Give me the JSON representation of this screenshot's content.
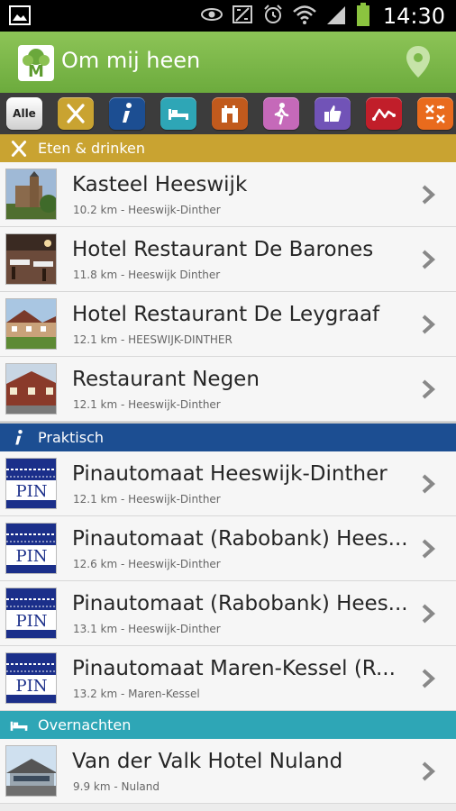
{
  "status_bar": {
    "time": "14:30",
    "icons": [
      "image-icon",
      "eye-icon",
      "nfc-icon",
      "alarm-icon",
      "wifi-icon",
      "signal-icon",
      "battery-icon"
    ]
  },
  "action_bar": {
    "title": "Om mij heen",
    "logo_letter": "M",
    "location_icon": "location-pin-icon",
    "color": "#7bb84a"
  },
  "filters": [
    {
      "label": "Alle",
      "icon": "text",
      "color": "#e6e6e6"
    },
    {
      "label": "",
      "icon": "fork-knife-icon",
      "color": "#c9a331"
    },
    {
      "label": "",
      "icon": "info-icon",
      "color": "#1c4e92"
    },
    {
      "label": "",
      "icon": "bed-icon",
      "color": "#2ea6b6"
    },
    {
      "label": "",
      "icon": "castle-icon",
      "color": "#c15a1d"
    },
    {
      "label": "",
      "icon": "walker-icon",
      "color": "#c569b9"
    },
    {
      "label": "",
      "icon": "thumbs-up-icon",
      "color": "#7153b7"
    },
    {
      "label": "",
      "icon": "route-icon",
      "color": "#c11e2a"
    },
    {
      "label": "",
      "icon": "tools-icon",
      "color": "#e96b1d"
    }
  ],
  "sections": [
    {
      "title": "Eten & drinken",
      "icon": "fork-knife-icon",
      "color": "#c9a331",
      "items": [
        {
          "title": "Kasteel Heeswijk",
          "subtitle": "10.2 km - Heeswijk-Dinther",
          "thumb": "castle-photo"
        },
        {
          "title": "Hotel Restaurant De Barones",
          "subtitle": "11.8 km - Heeswijk Dinther",
          "thumb": "dining-photo"
        },
        {
          "title": "Hotel Restaurant De Leygraaf",
          "subtitle": "12.1 km - HEESWIJK-DINTHER",
          "thumb": "building-photo"
        },
        {
          "title": "Restaurant Negen",
          "subtitle": "12.1 km - Heeswijk-Dinther",
          "thumb": "brick-photo"
        }
      ]
    },
    {
      "title": "Praktisch",
      "icon": "info-icon",
      "color": "#1c4e92",
      "items": [
        {
          "title": "Pinautomaat Heeswijk-Dinther",
          "subtitle": "12.1 km - Heeswijk-Dinther",
          "thumb": "pin-logo"
        },
        {
          "title": "Pinautomaat (Rabobank) Hees...",
          "subtitle": "12.6 km - Heeswijk-Dinther",
          "thumb": "pin-logo"
        },
        {
          "title": "Pinautomaat (Rabobank) Hees...",
          "subtitle": "13.1 km - Heeswijk-Dinther",
          "thumb": "pin-logo"
        },
        {
          "title": "Pinautomaat Maren-Kessel (R...",
          "subtitle": "13.2 km - Maren-Kessel",
          "thumb": "pin-logo"
        }
      ]
    },
    {
      "title": "Overnachten",
      "icon": "bed-icon",
      "color": "#2ea6b6",
      "items": [
        {
          "title": "Van der Valk Hotel Nuland",
          "subtitle": "9.9 km - Nuland",
          "thumb": "hotel-photo"
        }
      ]
    }
  ],
  "pin_text": "PIN"
}
